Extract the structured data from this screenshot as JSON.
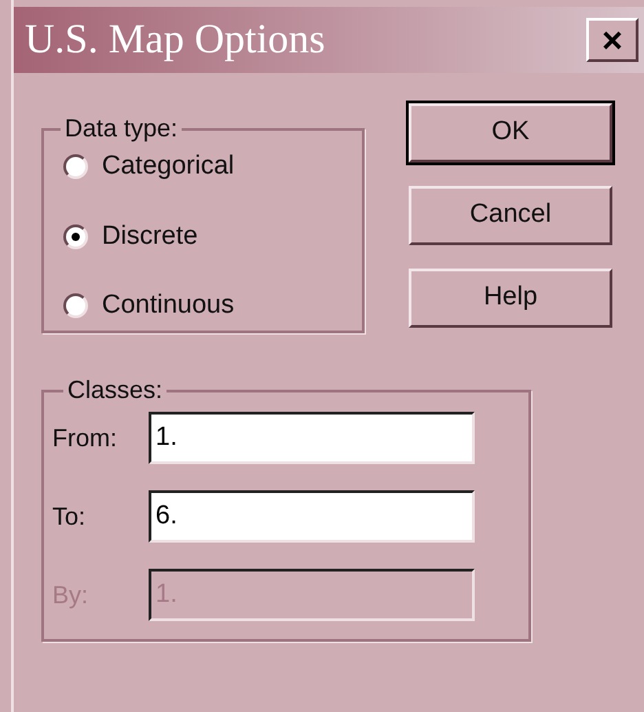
{
  "window": {
    "title": "U.S. Map Options",
    "close": "×"
  },
  "data_type": {
    "legend": "Data type:",
    "options": [
      {
        "label": "Categorical",
        "selected": false
      },
      {
        "label": "Discrete",
        "selected": true
      },
      {
        "label": "Continuous",
        "selected": false
      }
    ]
  },
  "buttons": [
    {
      "label": "OK",
      "default": true
    },
    {
      "label": "Cancel",
      "default": false
    },
    {
      "label": "Help",
      "default": false
    }
  ],
  "classes": {
    "legend": "Classes:",
    "fields": [
      {
        "label": "From:",
        "value": "1.",
        "disabled": false
      },
      {
        "label": "To:",
        "value": "6.",
        "disabled": false
      },
      {
        "label": "By:",
        "value": "1.",
        "disabled": true
      }
    ]
  }
}
